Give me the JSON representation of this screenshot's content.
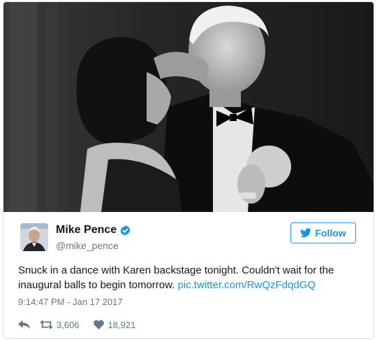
{
  "tweet": {
    "author_name": "Mike Pence",
    "author_handle": "@mike_pence",
    "follow_label": "Follow",
    "text": "Snuck in a dance with Karen backstage tonight. Couldn't wait for the inaugural balls to begin tomorrow.",
    "link_text": "pic.twitter.com/RwQzFdqdGQ",
    "timestamp": "9:14:47 PM - Jan 17 2017",
    "retweet_count": "3,606",
    "like_count": "18,921"
  },
  "colors": {
    "accent": "#1b95e0",
    "secondary_text": "#657786",
    "primary_text": "#14171a",
    "border": "#d8dde2"
  },
  "icons": {
    "verified": "verified-badge-icon",
    "follow": "twitter-bird-icon",
    "reply": "reply-arrow-icon",
    "retweet": "retweet-icon",
    "like": "heart-icon"
  }
}
